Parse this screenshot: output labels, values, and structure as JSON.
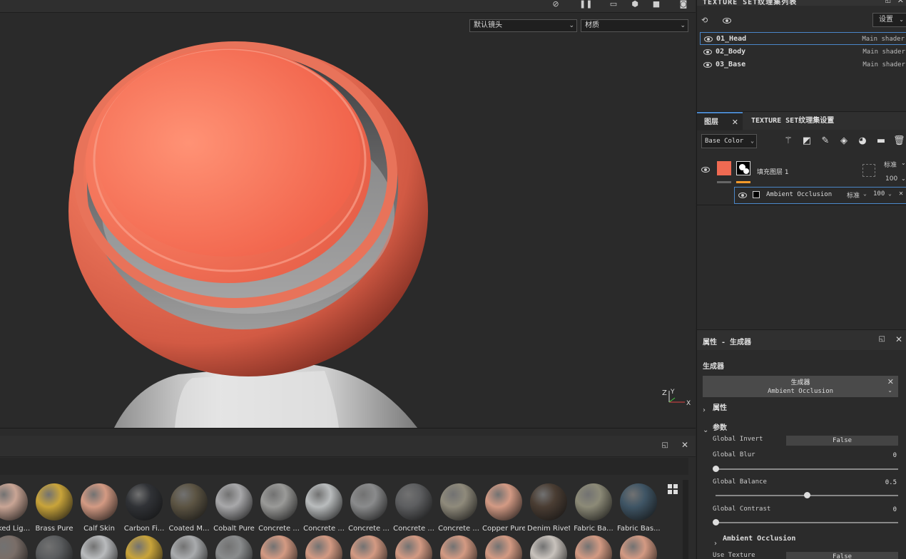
{
  "viewport": {
    "camera_select": "默认镜头",
    "channel_select": "材质"
  },
  "texture_sets": {
    "title": "TEXTURE SET纹理集列表",
    "settings_label": "设置",
    "rows": [
      {
        "name": "01_Head",
        "shader": "Main shader"
      },
      {
        "name": "02_Body",
        "shader": "Main shader"
      },
      {
        "name": "03_Base",
        "shader": "Main shader"
      }
    ]
  },
  "layers": {
    "tab_layers": "图层",
    "tab_settings": "TEXTURE SET纹理集设置",
    "channel": "Base Color",
    "fill_layer": {
      "name": "填充图层 1",
      "blend": "标准",
      "opacity": "100",
      "color": "#ef6a52"
    },
    "effect": {
      "name": "Ambient Occlusion",
      "blend": "标准",
      "opacity": "100"
    }
  },
  "properties": {
    "title": "属性 - 生成器",
    "section": "生成器",
    "generator_label": "生成器",
    "generator_name": "Ambient Occlusion",
    "group_attributes": "属性",
    "group_params": "参数",
    "params": [
      {
        "label": "Global Invert",
        "value": "False"
      },
      {
        "label": "Global Blur",
        "value": "0",
        "level": 0
      },
      {
        "label": "Global Balance",
        "value": "0.5",
        "level": 0.5
      },
      {
        "label": "Global Contrast",
        "value": "0",
        "level": 0
      }
    ],
    "subgroup": "Ambient Occlusion",
    "use_texture_label": "Use Texture",
    "use_texture_value": "False"
  },
  "shelf": {
    "row1": [
      {
        "label": "Baked Lig...",
        "color": "#c9a595"
      },
      {
        "label": "Brass Pure",
        "color": "#c9a43a"
      },
      {
        "label": "Calf Skin",
        "color": "#d39a83"
      },
      {
        "label": "Carbon Fi...",
        "color": "#303236"
      },
      {
        "label": "Coated M...",
        "color": "#5c5443"
      },
      {
        "label": "Cobalt Pure",
        "color": "#a8a8aa"
      },
      {
        "label": "Concrete ...",
        "color": "#9a9a98"
      },
      {
        "label": "Concrete ...",
        "color": "#b9bcbd"
      },
      {
        "label": "Concrete ...",
        "color": "#8a8b8c"
      },
      {
        "label": "Concrete ...",
        "color": "#5d5e60"
      },
      {
        "label": "Concrete ...",
        "color": "#8f8a7b"
      },
      {
        "label": "Copper Pure",
        "color": "#d39a84"
      },
      {
        "label": "Denim Rivet",
        "color": "#4a3d33"
      },
      {
        "label": "Fabric Ba...",
        "color": "#8c8a77"
      },
      {
        "label": "Fabric Bas...",
        "color": "#3f5565"
      }
    ],
    "row2_colors": [
      "#7a6e68",
      "#5a5c5e",
      "#b9bbbd",
      "#c9a43a",
      "#a9abad",
      "#8a8c8d",
      "#d39a83",
      "#d39a83",
      "#d39a83",
      "#d39a83",
      "#d39a83",
      "#d39a83",
      "#c8c2bc",
      "#d39a83",
      "#d39a83"
    ]
  },
  "colors": {
    "accent": "#4a86c8",
    "model": "#ef6a52"
  }
}
